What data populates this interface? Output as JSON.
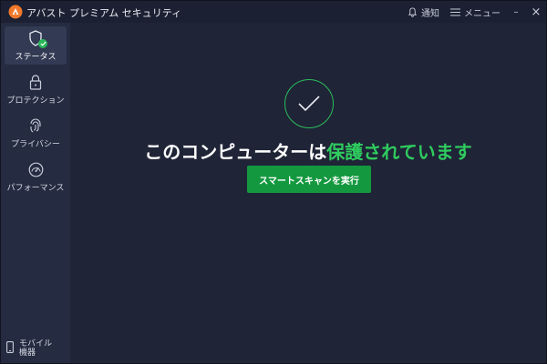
{
  "app": {
    "title": "アバスト プレミアム セキュリティ",
    "logo_icon": "avast-logo-icon",
    "brand_color": "#f0782a"
  },
  "titlebar": {
    "notifications_label": "通知",
    "menu_label": "メニュー",
    "minimize_glyph": "–",
    "close_glyph": "×"
  },
  "sidebar": {
    "items": [
      {
        "id": "status",
        "label": "ステータス",
        "icon": "shield-check-icon",
        "active": true
      },
      {
        "id": "protection",
        "label": "プロテクション",
        "icon": "lock-icon",
        "active": false
      },
      {
        "id": "privacy",
        "label": "プライバシー",
        "icon": "fingerprint-icon",
        "active": false
      },
      {
        "id": "performance",
        "label": "パフォーマンス",
        "icon": "speedometer-icon",
        "active": false
      }
    ],
    "mobile": {
      "label": "モバイル機器",
      "icon": "mobile-phone-icon"
    }
  },
  "main": {
    "headline_prefix": "このコンピューターは",
    "headline_status": "保護されています",
    "scan_button_label": "スマートスキャンを実行",
    "status_color": "#2fcc5e",
    "button_color": "#14983f"
  }
}
